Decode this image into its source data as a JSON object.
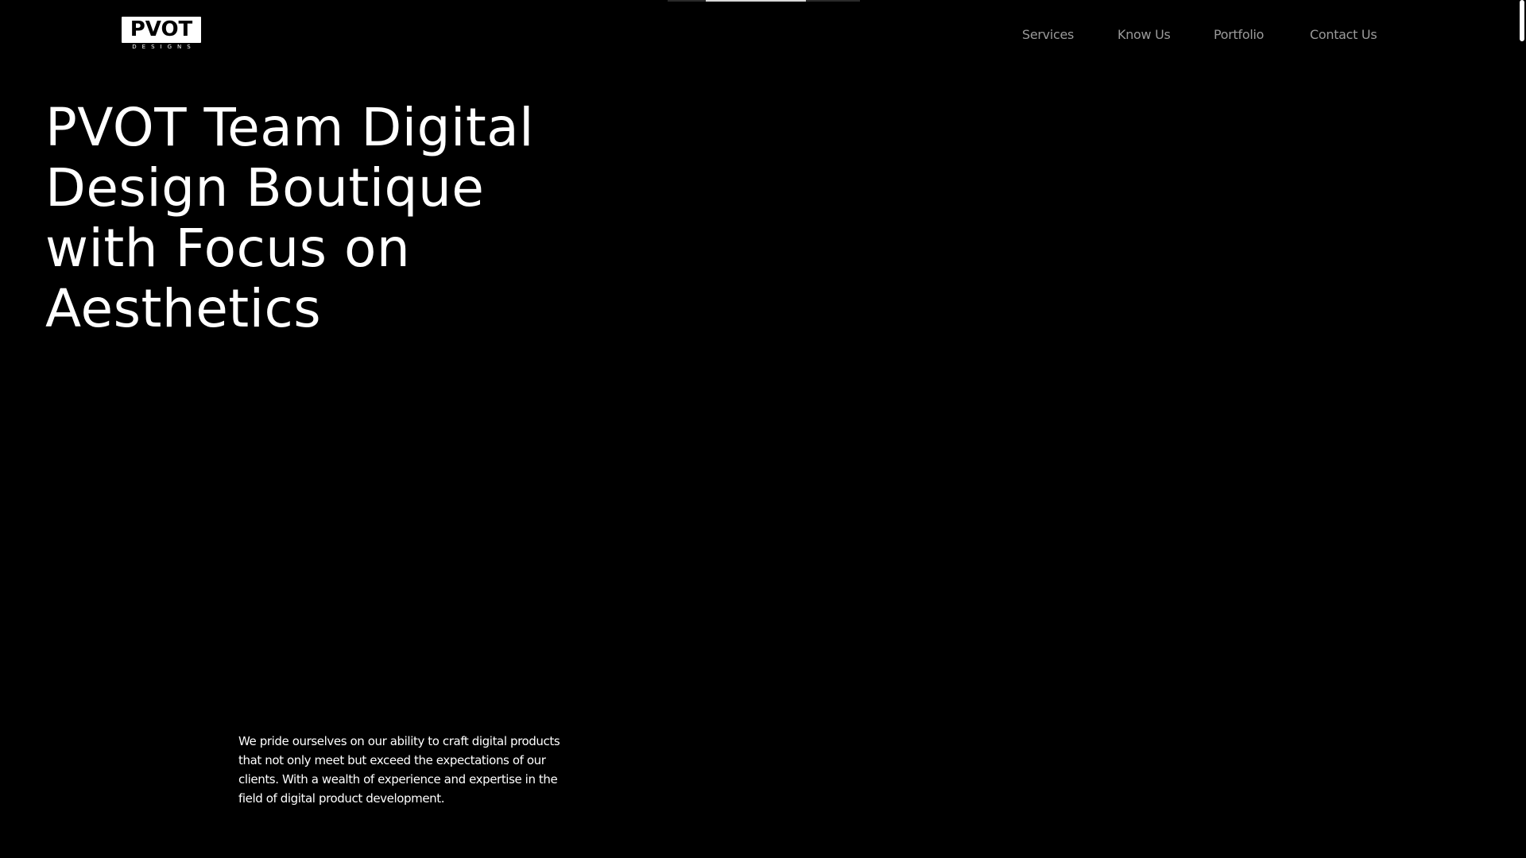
{
  "colors": {
    "background": "#000000",
    "text": "#ffffff",
    "nav_text": "#9a9a9a"
  },
  "page_progress": 0.65,
  "logo": {
    "wordmark": "PVOT",
    "subtitle": "DESIGNS"
  },
  "nav": {
    "items": [
      {
        "label": "Services"
      },
      {
        "label": "Know Us"
      },
      {
        "label": "Portfolio"
      },
      {
        "label": "Contact Us"
      }
    ]
  },
  "hero": {
    "title_lines": [
      "PVOT Team Digital",
      "Design Boutique",
      "with Focus on",
      "Aesthetics"
    ],
    "description_lines": [
      "We pride ourselves on our ability to craft digital products",
      "that not only meet but exceed the expectations of our",
      "clients. With a wealth of experience and expertise in the",
      "field of digital product development."
    ]
  }
}
